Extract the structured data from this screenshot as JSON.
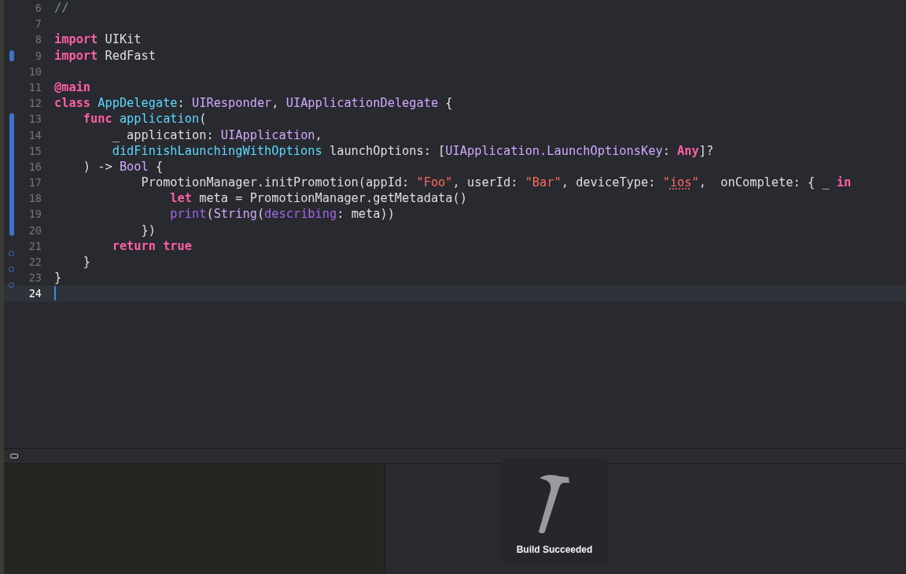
{
  "editor": {
    "lines": [
      {
        "number": "6",
        "changed": false,
        "deletion_marker": false,
        "current": false,
        "tokens": [
          {
            "kind": "comment",
            "text": "//"
          }
        ]
      },
      {
        "number": "7",
        "changed": false,
        "deletion_marker": false,
        "current": false
      },
      {
        "number": "8",
        "changed": false,
        "deletion_marker": false,
        "current": false,
        "tokens": [
          {
            "kind": "keyword",
            "text": "import"
          },
          {
            "kind": "plain",
            "text": " UIKit"
          }
        ]
      },
      {
        "number": "9",
        "changed": true,
        "deletion_marker": false,
        "current": false,
        "tokens": [
          {
            "kind": "keyword",
            "text": "import"
          },
          {
            "kind": "plain",
            "text": " RedFast"
          }
        ]
      },
      {
        "number": "10",
        "changed": false,
        "deletion_marker": false,
        "current": false
      },
      {
        "number": "11",
        "changed": false,
        "deletion_marker": false,
        "current": false,
        "tokens": [
          {
            "kind": "keyword",
            "text": "@main"
          }
        ]
      },
      {
        "number": "12",
        "changed": false,
        "deletion_marker": false,
        "current": false,
        "tokens": [
          {
            "kind": "keyword",
            "text": "class"
          },
          {
            "kind": "declaration",
            "text": " AppDelegate"
          },
          {
            "kind": "plain",
            "text": ": "
          },
          {
            "kind": "type",
            "text": "UIResponder"
          },
          {
            "kind": "plain",
            "text": ", "
          },
          {
            "kind": "type",
            "text": "UIApplicationDelegate"
          },
          {
            "kind": "plain",
            "text": " {"
          }
        ]
      },
      {
        "number": "13",
        "changed": true,
        "deletion_marker": false,
        "current": false,
        "tokens": [
          {
            "kind": "keyword",
            "text": "    func"
          },
          {
            "kind": "declaration",
            "text": " application"
          },
          {
            "kind": "plain",
            "text": "("
          }
        ]
      },
      {
        "number": "14",
        "changed": true,
        "deletion_marker": false,
        "current": false,
        "tokens": [
          {
            "kind": "plain",
            "text": "        _ application: "
          },
          {
            "kind": "type",
            "text": "UIApplication"
          },
          {
            "kind": "plain",
            "text": ","
          }
        ]
      },
      {
        "number": "15",
        "changed": true,
        "deletion_marker": false,
        "current": false,
        "tokens": [
          {
            "kind": "declaration",
            "text": "        didFinishLaunchingWithOptions"
          },
          {
            "kind": "plain",
            "text": " launchOptions: ["
          },
          {
            "kind": "type",
            "text": "UIApplication.LaunchOptionsKey"
          },
          {
            "kind": "plain",
            "text": ": "
          },
          {
            "kind": "keyword",
            "text": "Any"
          },
          {
            "kind": "plain",
            "text": "]?"
          }
        ]
      },
      {
        "number": "16",
        "changed": true,
        "deletion_marker": false,
        "current": false,
        "tokens": [
          {
            "kind": "plain",
            "text": "    ) -> "
          },
          {
            "kind": "type",
            "text": "Bool"
          },
          {
            "kind": "plain",
            "text": " {"
          }
        ]
      },
      {
        "number": "17",
        "changed": true,
        "deletion_marker": false,
        "current": false,
        "tokens": [
          {
            "kind": "plain",
            "text": "            PromotionManager.initPromotion(appId: "
          },
          {
            "kind": "string",
            "text": "\"Foo\""
          },
          {
            "kind": "plain",
            "text": ", userId: "
          },
          {
            "kind": "string",
            "text": "\"Bar\""
          },
          {
            "kind": "plain",
            "text": ", deviceType: "
          },
          {
            "kind": "string",
            "text": "\""
          },
          {
            "kind": "string",
            "text": "ios",
            "misspelled": true
          },
          {
            "kind": "string",
            "text": "\""
          },
          {
            "kind": "plain",
            "text": ",  onComplete: { _ "
          },
          {
            "kind": "keyword",
            "text": "in"
          }
        ]
      },
      {
        "number": "18",
        "changed": true,
        "deletion_marker": false,
        "current": false,
        "tokens": [
          {
            "kind": "keyword",
            "text": "                let"
          },
          {
            "kind": "plain",
            "text": " meta = PromotionManager.getMetadata()"
          }
        ]
      },
      {
        "number": "19",
        "changed": true,
        "deletion_marker": false,
        "current": false,
        "tokens": [
          {
            "kind": "call",
            "text": "                print"
          },
          {
            "kind": "plain",
            "text": "("
          },
          {
            "kind": "type",
            "text": "String"
          },
          {
            "kind": "plain",
            "text": "("
          },
          {
            "kind": "call",
            "text": "describing"
          },
          {
            "kind": "plain",
            "text": ": meta))"
          }
        ]
      },
      {
        "number": "20",
        "changed": true,
        "deletion_marker": false,
        "current": false,
        "tokens": [
          {
            "kind": "plain",
            "text": "            })"
          }
        ]
      },
      {
        "number": "21",
        "changed": false,
        "deletion_marker": false,
        "current": false,
        "tokens": [
          {
            "kind": "keyword",
            "text": "        return true"
          }
        ]
      },
      {
        "number": "22",
        "changed": false,
        "deletion_marker": true,
        "current": false,
        "tokens": [
          {
            "kind": "plain",
            "text": "    }"
          }
        ]
      },
      {
        "number": "23",
        "changed": false,
        "deletion_marker": true,
        "current": false,
        "tokens": [
          {
            "kind": "plain",
            "text": "}"
          }
        ]
      },
      {
        "number": "24",
        "changed": false,
        "deletion_marker": true,
        "current": true
      }
    ]
  },
  "build_notice": {
    "message": "Build Succeeded"
  }
}
